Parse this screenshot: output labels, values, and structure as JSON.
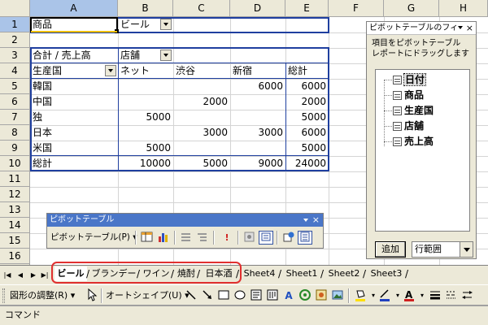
{
  "columns": [
    "A",
    "B",
    "C",
    "D",
    "E",
    "F",
    "G",
    "H"
  ],
  "rows": [
    "1",
    "2",
    "3",
    "4",
    "5",
    "6",
    "7",
    "8",
    "9",
    "10",
    "11",
    "12",
    "13",
    "14",
    "15",
    "16",
    "17"
  ],
  "cells": {
    "A1": "商品",
    "B1": "ビール",
    "A3": "合計 / 売上高",
    "B3": "店舗",
    "A4": "生産国",
    "B4": "ネット",
    "C4": "渋谷",
    "D4": "新宿",
    "E4": "総計",
    "A5": "韓国",
    "D5": "6000",
    "E5": "6000",
    "A6": "中国",
    "C6": "2000",
    "E6": "2000",
    "A7": "独",
    "B7": "5000",
    "E7": "5000",
    "A8": "日本",
    "C8": "3000",
    "D8": "3000",
    "E8": "6000",
    "A9": "米国",
    "B9": "5000",
    "E9": "5000",
    "A10": "総計",
    "B10": "10000",
    "C10": "5000",
    "D10": "9000",
    "E10": "24000"
  },
  "field_list": {
    "title": "ピボットテーブルのフィ",
    "description": "項目をピボットテーブル レポートにドラッグします",
    "fields": [
      "日付",
      "商品",
      "生産国",
      "店舗",
      "売上高"
    ],
    "add_button": "追加",
    "range_select": "行範囲"
  },
  "pivot_toolbar": {
    "title": "ピボットテーブル",
    "menu_label": "ピボットテーブル(P)",
    "menu_arrow": "▾"
  },
  "sheet_tabs": [
    "ビール",
    "ブランデー",
    "ワイン",
    "焼酎",
    "日本酒",
    "Sheet4",
    "Sheet1",
    "Sheet2",
    "Sheet3"
  ],
  "active_sheet": "ビール",
  "drawing_toolbar": {
    "adjust_menu": "図形の調整(R)",
    "autoshape_menu": "オートシェイプ(U)",
    "arrow": "▾"
  },
  "status": "コマンド",
  "colors": {
    "pivot_border": "#1f3f9f",
    "highlight_outline": "#e03030",
    "toolbar_title": "#4a76c8",
    "chrome": "#ece9d8"
  }
}
